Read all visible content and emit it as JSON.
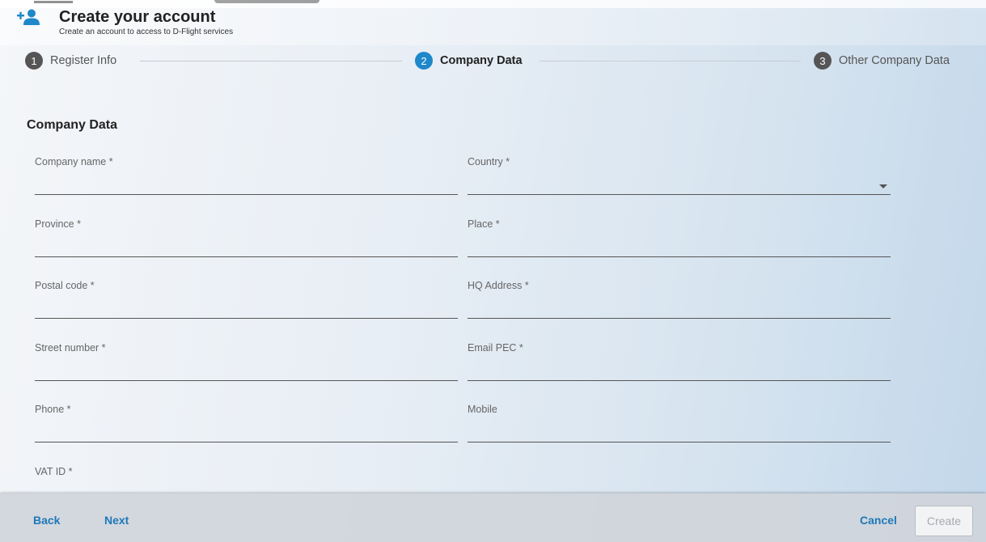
{
  "header": {
    "title": "Create your account",
    "subtitle": "Create an account to access to D-Flight services"
  },
  "stepper": {
    "steps": [
      {
        "number": "1",
        "label": "Register Info",
        "state": "done"
      },
      {
        "number": "2",
        "label": "Company Data",
        "state": "active"
      },
      {
        "number": "3",
        "label": "Other Company Data",
        "state": "pending"
      }
    ]
  },
  "form": {
    "section_title": "Company Data",
    "fields": {
      "company_name": {
        "label": "Company name *",
        "value": ""
      },
      "country": {
        "label": "Country *",
        "value": ""
      },
      "province": {
        "label": "Province *",
        "value": ""
      },
      "place": {
        "label": "Place *",
        "value": ""
      },
      "postal_code": {
        "label": "Postal code *",
        "value": ""
      },
      "hq_address": {
        "label": "HQ Address *",
        "value": ""
      },
      "street_number": {
        "label": "Street number *",
        "value": ""
      },
      "email_pec": {
        "label": "Email PEC *",
        "value": ""
      },
      "phone": {
        "label": "Phone *",
        "value": ""
      },
      "mobile": {
        "label": "Mobile",
        "value": ""
      },
      "vat_id": {
        "label": "VAT ID *",
        "value": ""
      }
    }
  },
  "footer": {
    "back": "Back",
    "next": "Next",
    "cancel": "Cancel",
    "create": "Create"
  },
  "colors": {
    "accent": "#1e88c9",
    "link": "#1e78b8",
    "step_inactive": "#555555"
  },
  "icons": {
    "header": "add-user-icon",
    "select": "chevron-down-icon"
  }
}
